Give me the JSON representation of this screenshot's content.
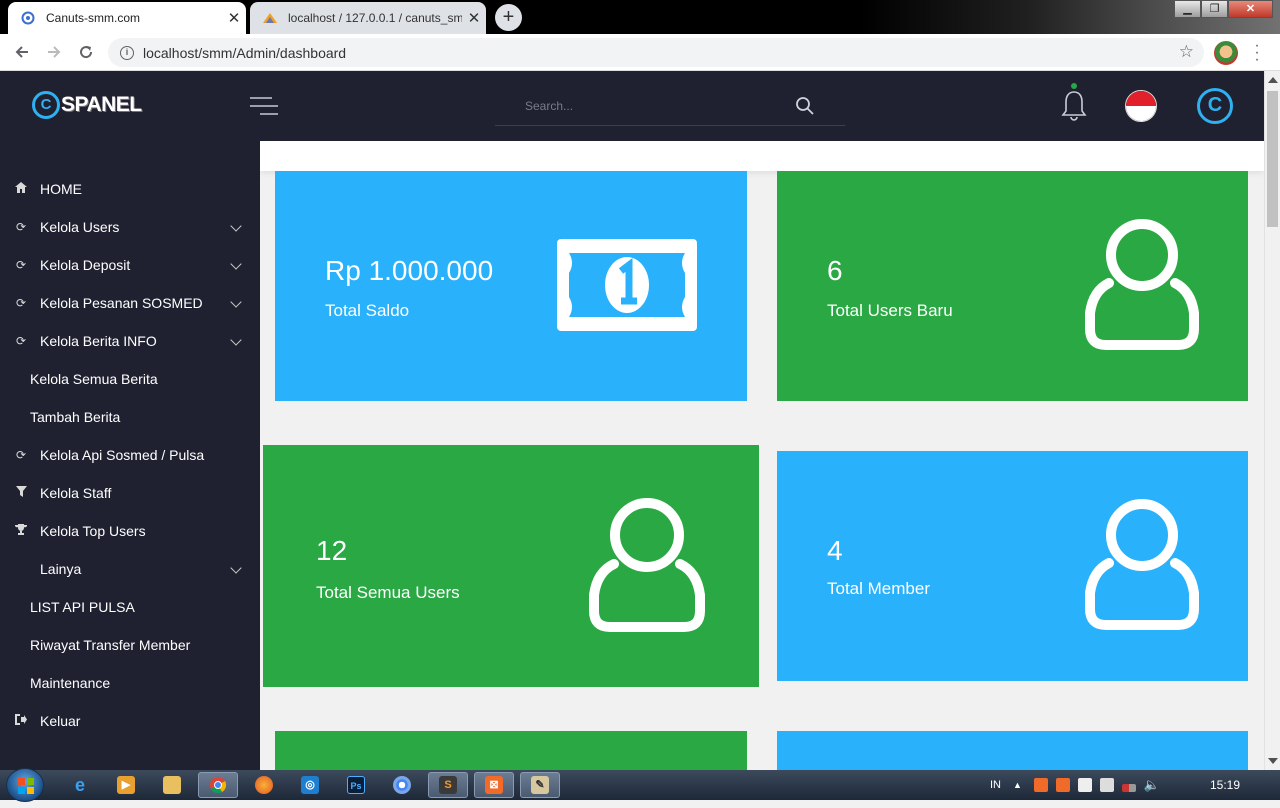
{
  "browser": {
    "tabs": [
      {
        "title": "Canuts-smm.com",
        "active": true
      },
      {
        "title": "localhost / 127.0.0.1 / canuts_smm",
        "active": false
      }
    ],
    "url": "localhost/smm/Admin/dashboard"
  },
  "header": {
    "logo_text": "SPANEL",
    "logo_mark": "C",
    "search_placeholder": "Search...",
    "avatar_letter": "C"
  },
  "sidebar": {
    "items": [
      {
        "label": "HOME",
        "icon": "home-icon",
        "chevron": false
      },
      {
        "label": "Kelola Users",
        "icon": "refresh-icon",
        "chevron": true
      },
      {
        "label": "Kelola Deposit",
        "icon": "refresh-icon",
        "chevron": true
      },
      {
        "label": "Kelola Pesanan SOSMED",
        "icon": "refresh-icon",
        "chevron": true
      },
      {
        "label": "Kelola Berita INFO",
        "icon": "refresh-icon",
        "chevron": true
      },
      {
        "label": "Kelola Semua Berita",
        "icon": "",
        "chevron": false
      },
      {
        "label": "Tambah Berita",
        "icon": "",
        "chevron": false
      },
      {
        "label": "Kelola Api Sosmed / Pulsa",
        "icon": "refresh-icon",
        "chevron": false
      },
      {
        "label": "Kelola Staff",
        "icon": "filter-icon",
        "chevron": false
      },
      {
        "label": "Kelola Top Users",
        "icon": "trophy-icon",
        "chevron": false
      },
      {
        "label": "Lainya",
        "icon": "",
        "chevron": true
      },
      {
        "label": "LIST API PULSA",
        "icon": "",
        "chevron": false
      },
      {
        "label": "Riwayat Transfer Member",
        "icon": "",
        "chevron": false
      },
      {
        "label": "Maintenance",
        "icon": "",
        "chevron": false
      },
      {
        "label": "Keluar",
        "icon": "sign-out-icon",
        "chevron": false
      }
    ]
  },
  "cards": [
    {
      "value": "Rp 1.000.000",
      "label": "Total Saldo",
      "color": "#29b1fb",
      "icon": "money-icon"
    },
    {
      "value": "6",
      "label": "Total Users Baru",
      "color": "#29a843",
      "icon": "user-icon"
    },
    {
      "value": "12",
      "label": "Total Semua Users",
      "color": "#29a843",
      "icon": "user-icon"
    },
    {
      "value": "4",
      "label": "Total Member",
      "color": "#29b1fb",
      "icon": "user-icon"
    }
  ],
  "taskbar": {
    "lang": "IN",
    "clock": "15:19"
  },
  "colors": {
    "sidebar_bg": "#1f2130",
    "accent_blue": "#29b1fb",
    "accent_green": "#29a843",
    "logo_blue": "#2fb0f0"
  }
}
